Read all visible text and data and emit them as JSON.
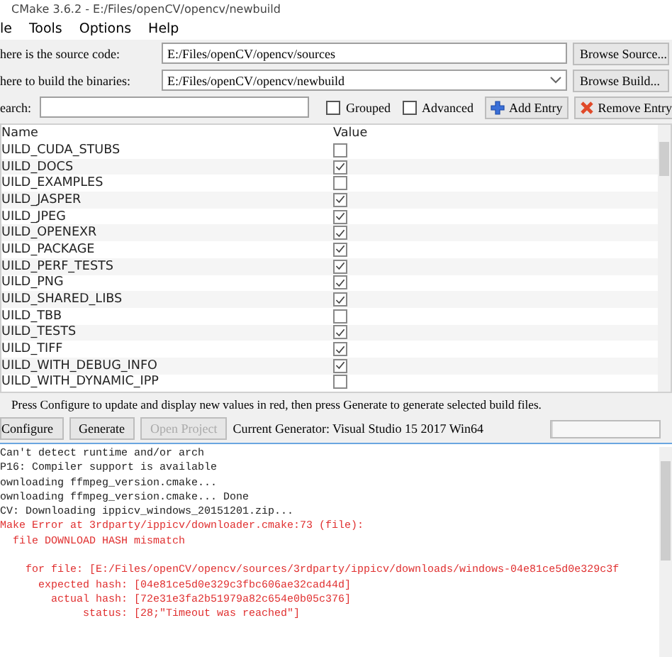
{
  "window": {
    "title": "CMake 3.6.2 - E:/Files/openCV/opencv/newbuild"
  },
  "menu": [
    "le",
    "Tools",
    "Options",
    "Help"
  ],
  "source": {
    "label": "here is the source code:",
    "value": "E:/Files/openCV/opencv/sources",
    "button": "Browse Source..."
  },
  "build": {
    "label": "here to build the binaries:",
    "value": "E:/Files/openCV/opencv/newbuild",
    "button": "Browse Build..."
  },
  "search": {
    "label": "earch:"
  },
  "options": [
    {
      "label": "Grouped",
      "checked": false
    },
    {
      "label": "Advanced",
      "checked": false
    }
  ],
  "add_entry": "Add Entry",
  "remove_entry": "Remove Entry",
  "table": {
    "columns": [
      "Name",
      "Value"
    ],
    "rows": [
      {
        "name": "UILD_CUDA_STUBS",
        "checked": false
      },
      {
        "name": "UILD_DOCS",
        "checked": true
      },
      {
        "name": "UILD_EXAMPLES",
        "checked": false
      },
      {
        "name": "UILD_JASPER",
        "checked": true
      },
      {
        "name": "UILD_JPEG",
        "checked": true
      },
      {
        "name": "UILD_OPENEXR",
        "checked": true
      },
      {
        "name": "UILD_PACKAGE",
        "checked": true
      },
      {
        "name": "UILD_PERF_TESTS",
        "checked": true
      },
      {
        "name": "UILD_PNG",
        "checked": true
      },
      {
        "name": "UILD_SHARED_LIBS",
        "checked": true
      },
      {
        "name": "UILD_TBB",
        "checked": false
      },
      {
        "name": "UILD_TESTS",
        "checked": true
      },
      {
        "name": "UILD_TIFF",
        "checked": true
      },
      {
        "name": "UILD_WITH_DEBUG_INFO",
        "checked": true
      },
      {
        "name": "UILD_WITH_DYNAMIC_IPP",
        "checked": false
      }
    ]
  },
  "hint": "Press Configure to update and display new values in red, then press Generate to generate selected build files.",
  "buttons": [
    {
      "label": "Configure",
      "disabled": false
    },
    {
      "label": "Generate",
      "disabled": false
    },
    {
      "label": "Open Project",
      "disabled": true
    }
  ],
  "generator": "Current Generator: Visual Studio 15 2017 Win64",
  "progress": {
    "level": 0
  },
  "output": [
    {
      "text": "Can't detect runtime and/or arch",
      "kind": "normal"
    },
    {
      "text": "P16: Compiler support is available",
      "kind": "normal"
    },
    {
      "text": "ownloading ffmpeg_version.cmake...",
      "kind": "normal"
    },
    {
      "text": "ownloading ffmpeg_version.cmake... Done",
      "kind": "normal"
    },
    {
      "text": "CV: Downloading ippicv_windows_20151201.zip...",
      "kind": "normal"
    },
    {
      "text": "Make Error at 3rdparty/ippicv/downloader.cmake:73 (file):",
      "kind": "error"
    },
    {
      "text": "  file DOWNLOAD HASH mismatch",
      "kind": "error"
    },
    {
      "text": "    for file: [E:/Files/openCV/opencv/sources/3rdparty/ippicv/downloads/windows-04e81ce5d0e329c3f",
      "kind": "error",
      "gap": true
    },
    {
      "text": "      expected hash: [04e81ce5d0e329c3fbc606ae32cad44d]",
      "kind": "error"
    },
    {
      "text": "        actual hash: [72e31e3fa2b51979a82c654e0b05c376]",
      "kind": "error"
    },
    {
      "text": "             status: [28;\"Timeout was reached\"]",
      "kind": "error"
    }
  ]
}
